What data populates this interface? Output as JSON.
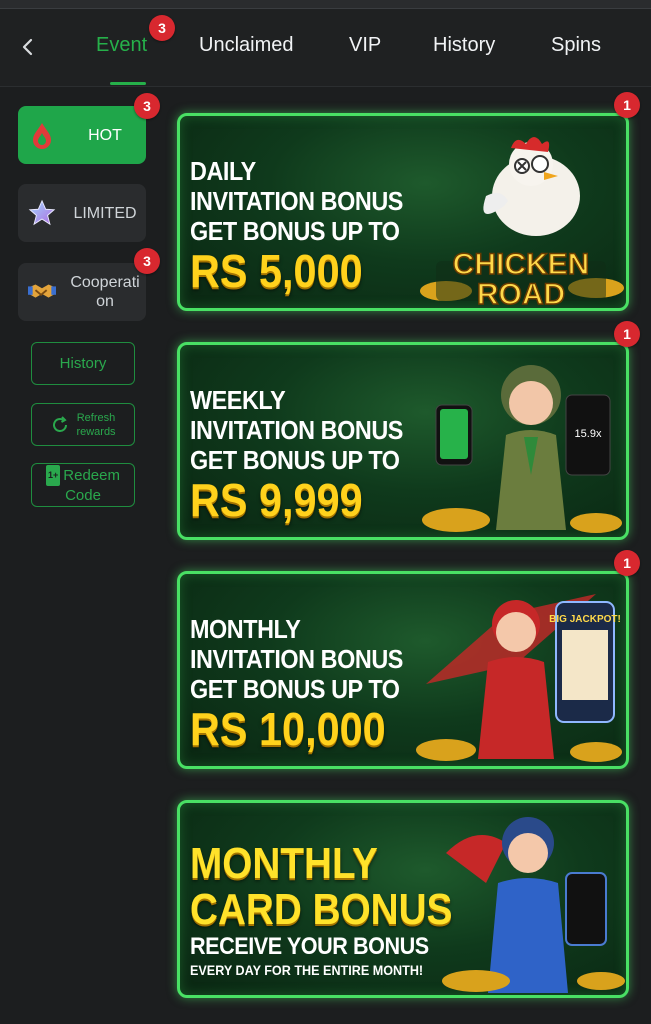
{
  "nav": {
    "tabs": [
      {
        "label": "Event",
        "active": true,
        "badge": "3"
      },
      {
        "label": "Unclaimed"
      },
      {
        "label": "VIP"
      },
      {
        "label": "History"
      },
      {
        "label": "Spins"
      }
    ]
  },
  "sidebar": {
    "categories": [
      {
        "label": "HOT",
        "icon": "flame-drop-icon",
        "active": true,
        "badge": "3"
      },
      {
        "label": "LIMITED",
        "icon": "star-icon"
      },
      {
        "label": "Cooperati on",
        "label_line1": "Cooperati",
        "label_line2": "on",
        "icon": "handshake-icon",
        "badge": "3"
      }
    ],
    "history_label": "History",
    "refresh_label_line1": "Refresh",
    "refresh_label_line2": "rewards",
    "redeem_label_line1": "Redeem",
    "redeem_label_line2": "Code",
    "redeem_icon_text": "1+"
  },
  "banners": [
    {
      "lines": [
        "DAILY",
        "INVITATION BONUS",
        "GET BONUS UP TO"
      ],
      "amount": "RS 5,000",
      "badge": "1",
      "art_logo_line1": "CHICKEN",
      "art_logo_line2": "ROAD"
    },
    {
      "lines": [
        "WEEKLY",
        "INVITATION BONUS",
        "GET BONUS UP TO"
      ],
      "amount": "RS 9,999",
      "badge": "1",
      "art_screen_text": "15.9x"
    },
    {
      "lines": [
        "MONTHLY",
        "INVITATION BONUS",
        "GET BONUS UP TO"
      ],
      "amount": "RS 10,000",
      "badge": "1",
      "art_logo": "BIG JACKPOT!"
    },
    {
      "big_lines": [
        "MONTHLY",
        "CARD BONUS"
      ],
      "sub": "RECEIVE YOUR BONUS",
      "small": "EVERY DAY FOR THE ENTIRE MONTH!"
    }
  ],
  "colors": {
    "accent": "#26b04a",
    "badge": "#d8282f",
    "banner_border": "#49e064",
    "gold": "#ffd21c"
  }
}
